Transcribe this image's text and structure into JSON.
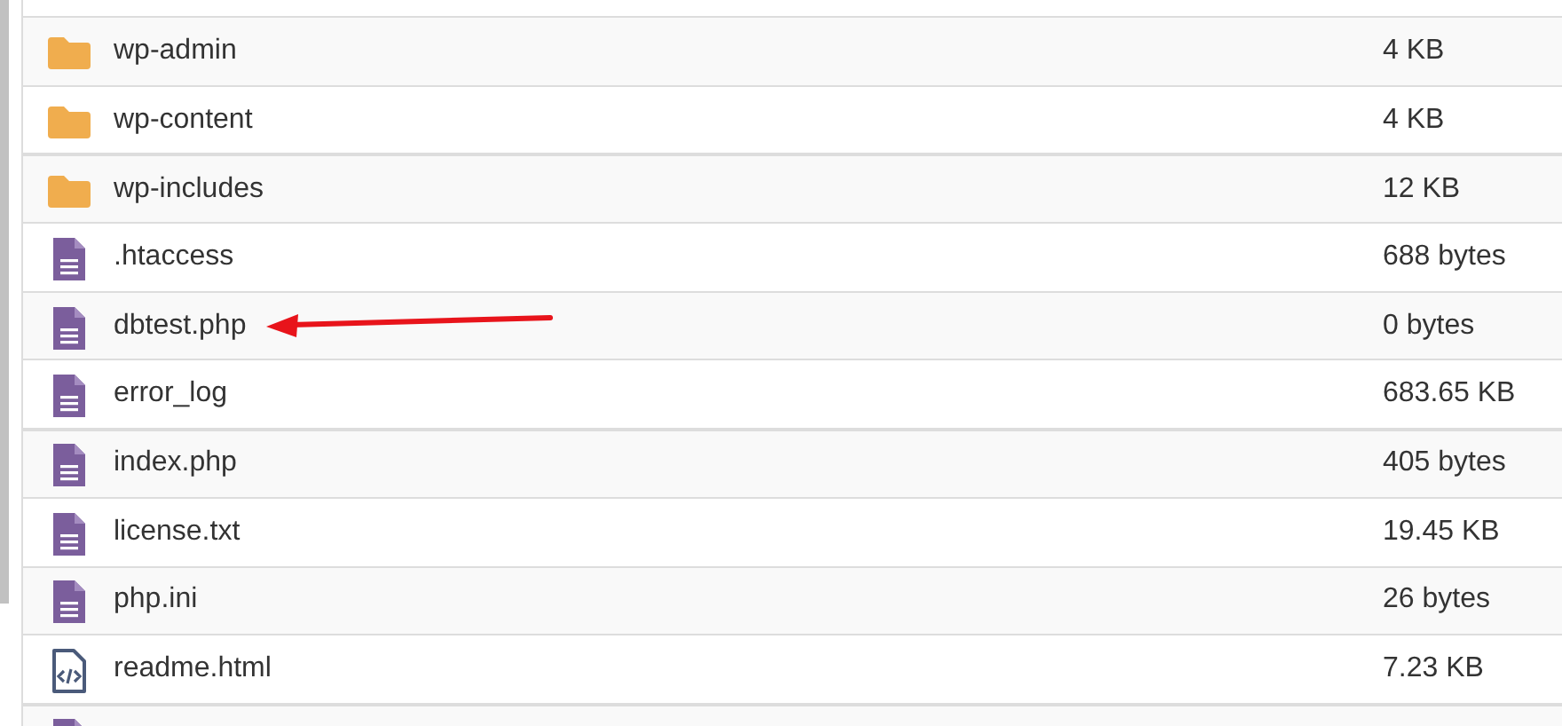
{
  "files": [
    {
      "kind": "folder",
      "name": "wp-admin",
      "size": "4 KB",
      "arrow": false
    },
    {
      "kind": "folder",
      "name": "wp-content",
      "size": "4 KB",
      "arrow": false
    },
    {
      "kind": "folder",
      "name": "wp-includes",
      "size": "12 KB",
      "arrow": false
    },
    {
      "kind": "file",
      "name": ".htaccess",
      "size": "688 bytes",
      "arrow": false
    },
    {
      "kind": "file",
      "name": "dbtest.php",
      "size": "0 bytes",
      "arrow": true
    },
    {
      "kind": "file",
      "name": "error_log",
      "size": "683.65 KB",
      "arrow": false
    },
    {
      "kind": "file",
      "name": "index.php",
      "size": "405 bytes",
      "arrow": false
    },
    {
      "kind": "file",
      "name": "license.txt",
      "size": "19.45 KB",
      "arrow": false
    },
    {
      "kind": "file",
      "name": "php.ini",
      "size": "26 bytes",
      "arrow": false
    },
    {
      "kind": "code",
      "name": "readme.html",
      "size": "7.23 KB",
      "arrow": false
    },
    {
      "kind": "file"
    }
  ]
}
